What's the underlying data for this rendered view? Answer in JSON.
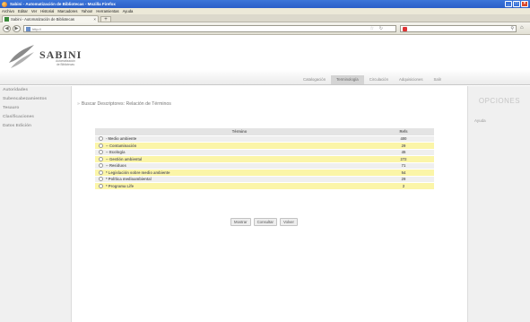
{
  "browser": {
    "window_title": "Sabini - Automatización de Bibliotecas - Mozilla Firefox",
    "menu": [
      "Archivo",
      "Editar",
      "Ver",
      "Historial",
      "Marcadores",
      "Yahoo!",
      "Herramientas",
      "Ayuda"
    ],
    "tab_title": "Sabini - Automatización de Bibliotecas",
    "url_value": "http://"
  },
  "app": {
    "logo_name": "SABINI",
    "logo_sub_line1": "Automatización",
    "logo_sub_line2": "de Bibliotecas",
    "topnav": [
      "Catalogación",
      "Terminología",
      "Circulación",
      "Adquisiciones",
      "Salir"
    ],
    "active_topnav": "Terminología",
    "sidebar": [
      "Autoridades",
      "Subencabezamientos",
      "Tesauro",
      "Clasificaciones",
      "Datos Edición"
    ],
    "right": {
      "options_title": "OPCIONES",
      "help": "Ayuda"
    }
  },
  "main": {
    "title": "Buscar Descriptores: Relación de Términos",
    "table": {
      "col_term": "Término",
      "col_count": "Refs",
      "rows": [
        {
          "term": "- Medio ambiente",
          "count": "400"
        },
        {
          "term": "-- Contaminación",
          "count": "29"
        },
        {
          "term": "-- Ecología",
          "count": "45"
        },
        {
          "term": "-- Gestión ambiental",
          "count": "272"
        },
        {
          "term": "-- Residuos",
          "count": "71"
        },
        {
          "term": "* Legislación sobre medio ambiente",
          "count": "54"
        },
        {
          "term": "* Política medioambiental",
          "count": "29"
        },
        {
          "term": "* Programa Life",
          "count": "2"
        }
      ]
    },
    "buttons": {
      "show": "Mostrar",
      "consult": "Consultar",
      "back": "Volver"
    }
  }
}
